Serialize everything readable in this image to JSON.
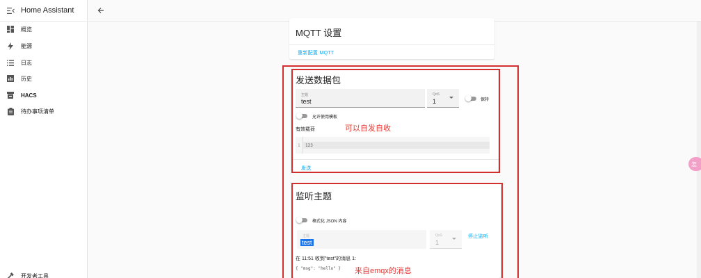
{
  "app": {
    "title": "Home Assistant"
  },
  "sidebar": {
    "items": [
      {
        "label": "概览",
        "icon": "dashboard-icon"
      },
      {
        "label": "能源",
        "icon": "lightning-icon"
      },
      {
        "label": "日志",
        "icon": "list-icon"
      },
      {
        "label": "历史",
        "icon": "chart-icon"
      },
      {
        "label": "HACS",
        "icon": "hacs-icon"
      },
      {
        "label": "待办事项清单",
        "icon": "clipboard-icon"
      }
    ],
    "bottom": {
      "label": "开发者工具",
      "icon": "hammer-icon"
    }
  },
  "settings_card": {
    "title": "MQTT 设置",
    "reconfigure_label": "重新配置 MQTT"
  },
  "publish_card": {
    "title": "发送数据包",
    "topic": {
      "label": "主题",
      "value": "test"
    },
    "qos": {
      "label": "QoS",
      "value": "1"
    },
    "retain_label": "保持",
    "template_label": "允许使用模板",
    "payload_label": "有效载荷",
    "payload": {
      "line_number": "1",
      "code": "123"
    },
    "send_label": "发送",
    "annotation": "可以自发自收"
  },
  "listen_card": {
    "title": "监听主题",
    "format_json_label": "格式化 JSON 内容",
    "topic": {
      "label": "主题",
      "value": "test"
    },
    "qos": {
      "label": "QoS",
      "value": "1"
    },
    "stop_label": "停止监听",
    "message_header": "在 11:51 收到\"test\"的消息 1:",
    "message_body": "{ \"msg\": \"hello\" }",
    "annotation": "来自emqx的消息"
  },
  "float_button": {
    "label": "怎"
  },
  "colors": {
    "accent": "#03a9f4",
    "annotation_red": "#d32f2f"
  }
}
